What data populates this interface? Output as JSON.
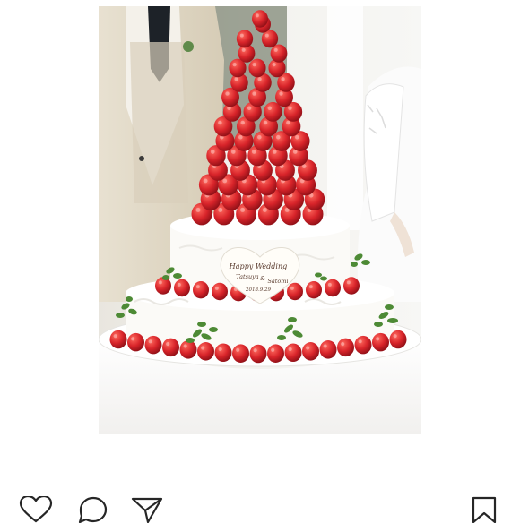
{
  "post": {
    "photo": {
      "subject": "tiered-wedding-cake-with-strawberry-tower",
      "plaque_lines": [
        "Happy Wedding",
        "Tatsuya",
        "&",
        "Satomi",
        "2018.9.29"
      ]
    }
  },
  "actions": {
    "like_icon": "heart-outline-icon",
    "comment_icon": "speech-bubble-icon",
    "share_icon": "paper-plane-icon",
    "save_icon": "bookmark-icon"
  },
  "colors": {
    "strawberry": "#d8242a",
    "cream": "#fbfaf7",
    "icon": "#262626"
  }
}
